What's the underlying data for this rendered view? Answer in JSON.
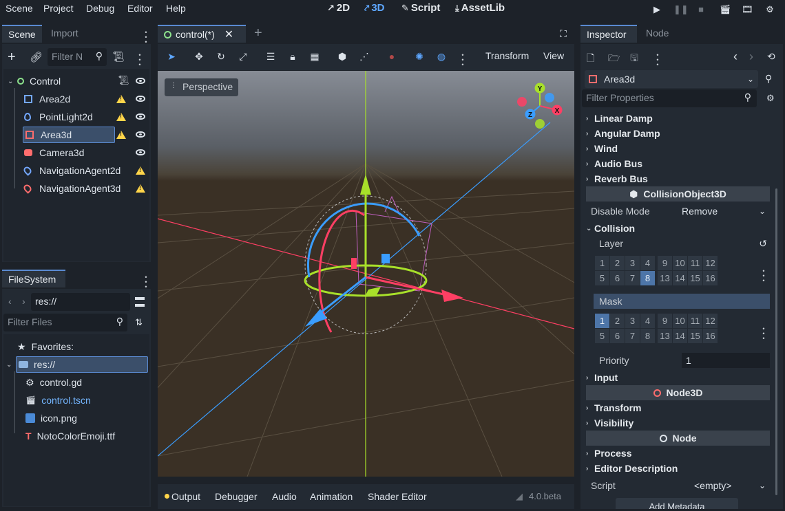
{
  "menubar": {
    "menus": [
      "Scene",
      "Project",
      "Debug",
      "Editor",
      "Help"
    ],
    "workspaces": [
      {
        "label": "2D",
        "icon": "2d-icon",
        "active": false
      },
      {
        "label": "3D",
        "icon": "3d-icon",
        "active": true
      },
      {
        "label": "Script",
        "icon": "script-icon",
        "active": false
      },
      {
        "label": "AssetLib",
        "icon": "assetlib-icon",
        "active": false
      }
    ],
    "run_buttons": [
      "play-icon",
      "pause-icon",
      "stop-icon",
      "play-scene-icon",
      "play-custom-scene-icon",
      "movie-maker-icon"
    ]
  },
  "scene_dock": {
    "tabs": [
      "Scene",
      "Import"
    ],
    "filter_placeholder": "Filter N",
    "tree": [
      {
        "label": "Control",
        "icon": "control-icon",
        "depth": 0,
        "warning": false,
        "visible": true,
        "script": true
      },
      {
        "label": "Area2d",
        "icon": "area2d-icon",
        "depth": 1,
        "warning": true,
        "visible": true
      },
      {
        "label": "PointLight2d",
        "icon": "pointlight2d-icon",
        "depth": 1,
        "warning": true,
        "visible": true
      },
      {
        "label": "Area3d",
        "icon": "area3d-icon",
        "depth": 1,
        "warning": true,
        "visible": true,
        "selected": true
      },
      {
        "label": "Camera3d",
        "icon": "camera3d-icon",
        "depth": 1,
        "warning": false,
        "visible": true
      },
      {
        "label": "NavigationAgent2d",
        "icon": "navagent2d-icon",
        "depth": 1,
        "warning": true,
        "visible": false
      },
      {
        "label": "NavigationAgent3d",
        "icon": "navagent3d-icon",
        "depth": 1,
        "warning": true,
        "visible": false
      }
    ]
  },
  "filesystem_dock": {
    "tab": "FileSystem",
    "path": "res://",
    "filter_placeholder": "Filter Files",
    "items": [
      {
        "label": "Favorites:",
        "icon": "star-icon"
      },
      {
        "label": "res://",
        "icon": "folder-icon",
        "selected": true
      },
      {
        "label": "control.gd",
        "icon": "gear-icon"
      },
      {
        "label": "control.tscn",
        "icon": "scene-icon",
        "highlight": true
      },
      {
        "label": "icon.png",
        "icon": "image-icon"
      },
      {
        "label": "NotoColorEmoji.ttf",
        "icon": "font-icon"
      }
    ]
  },
  "viewport": {
    "tab_label": "control(*)",
    "toolbar_menus": [
      "Transform",
      "View"
    ],
    "perspective_label": "Perspective",
    "gizmo_axes": [
      "Y",
      "X",
      "Z"
    ]
  },
  "bottom_panel": {
    "tabs": [
      "Output",
      "Debugger",
      "Audio",
      "Animation",
      "Shader Editor"
    ],
    "version": "4.0.beta"
  },
  "inspector": {
    "tabs": [
      "Inspector",
      "Node"
    ],
    "object_name": "Area3d",
    "filter_placeholder": "Filter Properties",
    "groups_top": [
      "Linear Damp",
      "Angular Damp",
      "Wind",
      "Audio Bus",
      "Reverb Bus"
    ],
    "section_collision_object": "CollisionObject3D",
    "disable_mode_label": "Disable Mode",
    "disable_mode_value": "Remove",
    "collision_label": "Collision",
    "layer_label": "Layer",
    "mask_label": "Mask",
    "layer_grid": [
      "1",
      "2",
      "3",
      "4",
      "9",
      "10",
      "11",
      "12",
      "5",
      "6",
      "7",
      "8",
      "13",
      "14",
      "15",
      "16"
    ],
    "layer_on": [
      "8"
    ],
    "mask_on": [
      "1"
    ],
    "priority_label": "Priority",
    "priority_value": "1",
    "input_label": "Input",
    "section_node3d": "Node3D",
    "transform_label": "Transform",
    "visibility_label": "Visibility",
    "section_node": "Node",
    "process_label": "Process",
    "editor_desc_label": "Editor Description",
    "script_label": "Script",
    "script_value": "<empty>",
    "add_metadata_label": "Add Metadata"
  },
  "colors": {
    "accent": "#5ea7ff",
    "warning": "#ffd54a",
    "axis_x": "#ff3f64",
    "axis_y": "#a8e02a",
    "axis_z": "#3a9dff"
  }
}
